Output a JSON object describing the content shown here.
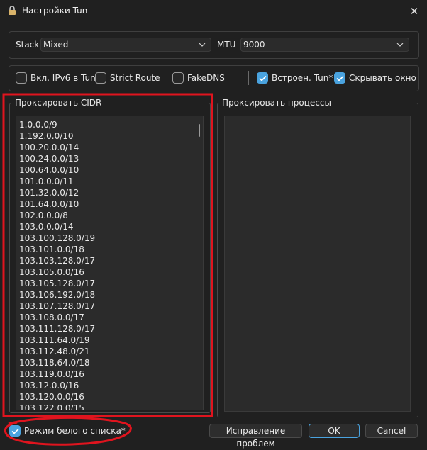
{
  "window": {
    "title": "Настройки Tun"
  },
  "stack": {
    "label": "Stack",
    "value": "Mixed"
  },
  "mtu": {
    "label": "MTU",
    "value": "9000"
  },
  "options": [
    {
      "label": "Вкл. IPv6 в Tun",
      "checked": false
    },
    {
      "label": "Strict Route",
      "checked": false
    },
    {
      "label": "FakeDNS",
      "checked": false
    },
    {
      "label": "Встроен. Tun*",
      "checked": true
    },
    {
      "label": "Скрывать окно",
      "checked": true
    }
  ],
  "cidr": {
    "title": "Проксировать CIDR",
    "items": [
      "1.0.0.0/9",
      "1.192.0.0/10",
      "100.20.0.0/14",
      "100.24.0.0/13",
      "100.64.0.0/10",
      "101.0.0.0/11",
      "101.32.0.0/12",
      "101.64.0.0/10",
      "102.0.0.0/8",
      "103.0.0.0/14",
      "103.100.128.0/19",
      "103.101.0.0/18",
      "103.103.128.0/17",
      "103.105.0.0/16",
      "103.105.128.0/17",
      "103.106.192.0/18",
      "103.107.128.0/17",
      "103.108.0.0/17",
      "103.111.128.0/17",
      "103.111.64.0/19",
      "103.112.48.0/21",
      "103.118.64.0/18",
      "103.119.0.0/16",
      "103.12.0.0/16",
      "103.120.0.0/16",
      "103.122.0.0/15"
    ]
  },
  "processes": {
    "title": "Проксировать процессы"
  },
  "whitelist": {
    "label": "Режим белого списка*",
    "checked": true
  },
  "buttons": {
    "troubleshoot": "Исправление проблем",
    "ok": "OK",
    "cancel": "Cancel"
  },
  "colors": {
    "accent": "#4aa3df",
    "annotation": "#e0141e",
    "background": "#202020"
  }
}
